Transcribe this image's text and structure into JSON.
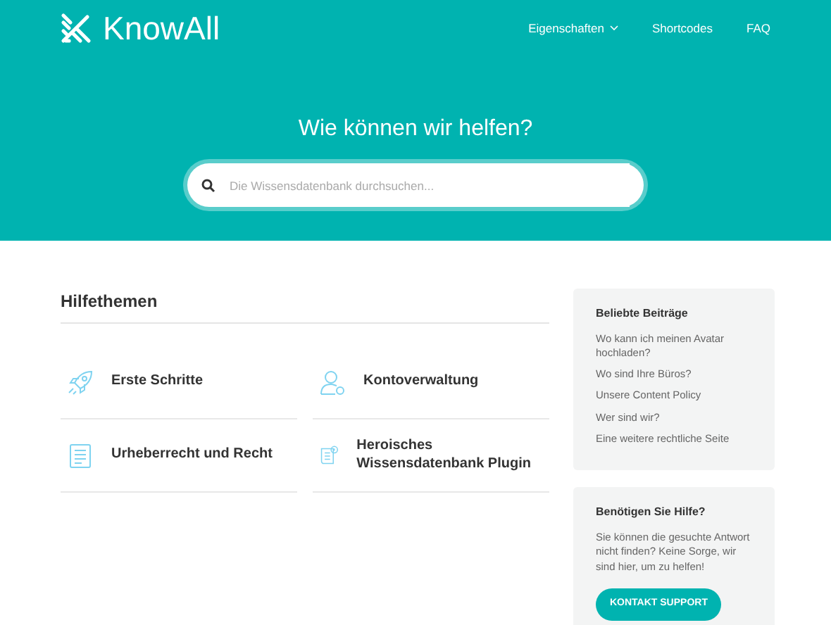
{
  "brand": "KnowAll",
  "nav": [
    {
      "label": "Eigenschaften",
      "dropdown": true
    },
    {
      "label": "Shortcodes",
      "dropdown": false
    },
    {
      "label": "FAQ",
      "dropdown": false
    }
  ],
  "hero": {
    "title": "Wie können wir helfen?",
    "search": {
      "placeholder": "Die Wissensdatenbank durchsuchen..."
    }
  },
  "topics": {
    "title": "Hilfethemen",
    "items": [
      {
        "label": "Erste Schritte"
      },
      {
        "label": "Kontoverwaltung"
      },
      {
        "label": "Urheberrecht und Recht"
      },
      {
        "label": "Heroisches Wissensdatenbank Plugin"
      }
    ]
  },
  "popular": {
    "title": "Beliebte Beiträge",
    "links": [
      "Wo kann ich meinen Avatar hochladen?",
      "Wo sind Ihre Büros?",
      "Unsere Content Policy",
      "Wer sind wir?",
      "Eine weitere rechtliche Seite"
    ]
  },
  "help": {
    "title": "Benötigen Sie Hilfe?",
    "text": "Sie können die gesuchte Antwort nicht finden? Keine Sorge, wir sind hier, um zu helfen!",
    "button": "KONTAKT SUPPORT"
  }
}
